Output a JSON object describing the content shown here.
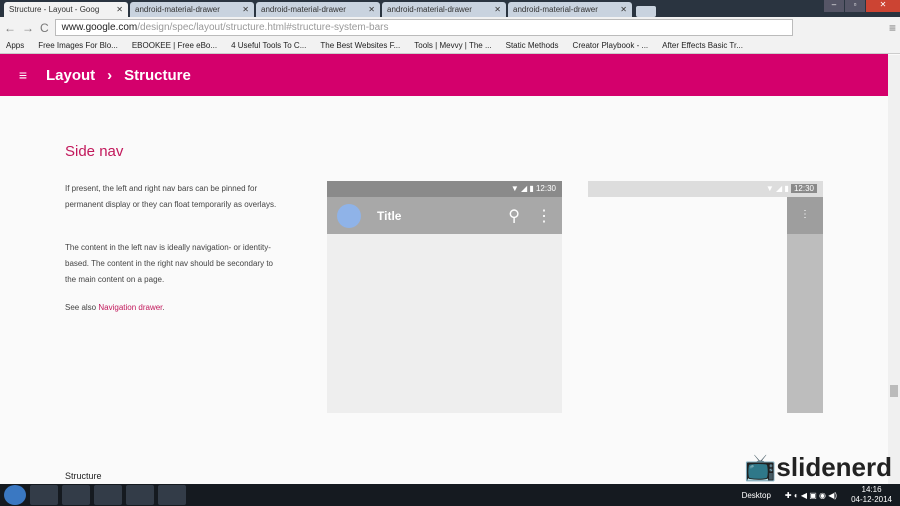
{
  "browser": {
    "tabs": [
      {
        "label": "Structure - Layout - Goog",
        "active": true
      },
      {
        "label": "android-material-drawer"
      },
      {
        "label": "android-material-drawer"
      },
      {
        "label": "android-material-drawer"
      },
      {
        "label": "android-material-drawer"
      }
    ],
    "url_host": "www.google.com",
    "url_path": "/design/spec/layout/structure.html#structure-system-bars",
    "bookmarks": [
      "Apps",
      "Free Images For Blo...",
      "EBOOKEE | Free eBo...",
      "4 Useful Tools To C...",
      "The Best Websites F...",
      "Tools | Mevvy | The ...",
      "Static Methods",
      "Creator Playbook - ...",
      "After Effects Basic Tr..."
    ]
  },
  "appbar": {
    "crumb1": "Layout",
    "sep": "›",
    "crumb2": "Structure"
  },
  "section": {
    "title": "Side nav",
    "p1": "If present, the left and right nav bars can be pinned for permanent display or they can float temporarily as overlays.",
    "p2": "The content in the left nav is ideally navigation- or identity-based. The content in the right nav should be secondary to the main content on a page.",
    "p3_prefix": "See also ",
    "p3_link": "Navigation drawer",
    "p3_suffix": ".",
    "next": "Structure"
  },
  "phone1": {
    "time": "12:30",
    "title": "Title"
  },
  "phone2": {
    "time": "12:30"
  },
  "watermark": "slidenerd",
  "taskbar": {
    "desktop": "Desktop",
    "time": "14:16",
    "date": "04-12-2014"
  }
}
